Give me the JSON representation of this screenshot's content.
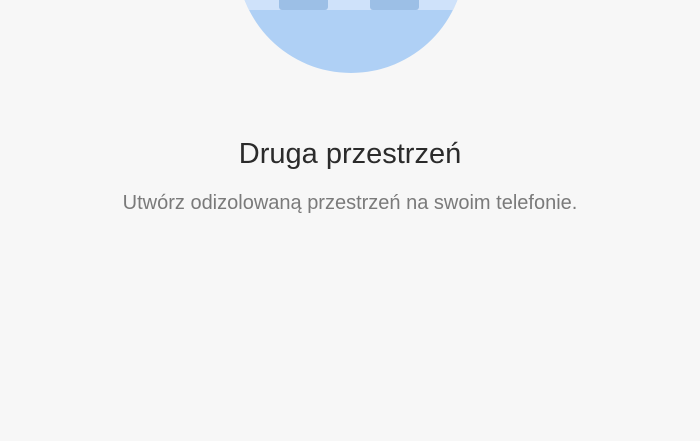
{
  "page": {
    "title": "Druga przestrzeń",
    "subtitle": "Utwórz odizolowaną przestrzeń na swoim telefonie."
  },
  "illustration": {
    "icon": "second-space-illustration",
    "color": "#afd0f5"
  }
}
